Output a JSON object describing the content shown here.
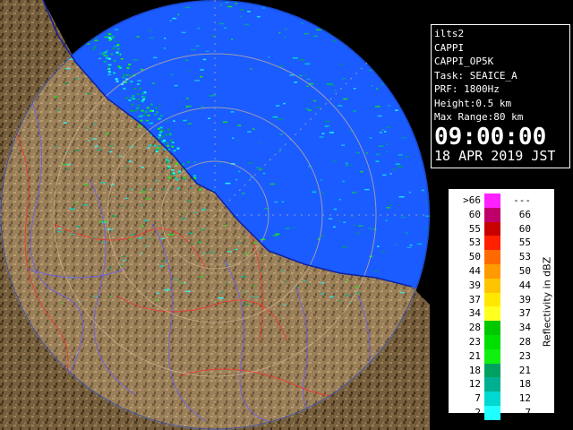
{
  "info": {
    "radar_name": "ilts2",
    "product": "CAPPI",
    "product_id": "CAPPI_OP5K",
    "task": "Task: SEAICE_A",
    "prf": "PRF: 1800Hz",
    "height": "Height:0.5 km",
    "max_range": "Max Range:80 km",
    "time": "09:00:00",
    "date": "18 APR 2019 JST"
  },
  "legend": {
    "title": "Reflectivity in dBZ",
    "rows": [
      {
        "lo": ">66",
        "hi": "---",
        "color": "#ff20ff"
      },
      {
        "lo": "60",
        "hi": "66",
        "color": "#c0006a"
      },
      {
        "lo": "55",
        "hi": "60",
        "color": "#c80000"
      },
      {
        "lo": "53",
        "hi": "55",
        "color": "#ff2000"
      },
      {
        "lo": "50",
        "hi": "53",
        "color": "#ff6a00"
      },
      {
        "lo": "44",
        "hi": "50",
        "color": "#ff9a00"
      },
      {
        "lo": "39",
        "hi": "44",
        "color": "#ffc400"
      },
      {
        "lo": "37",
        "hi": "39",
        "color": "#ffe800"
      },
      {
        "lo": "34",
        "hi": "37",
        "color": "#ffff20"
      },
      {
        "lo": "28",
        "hi": "34",
        "color": "#00c800"
      },
      {
        "lo": "23",
        "hi": "28",
        "color": "#00e000"
      },
      {
        "lo": "21",
        "hi": "23",
        "color": "#10f010"
      },
      {
        "lo": "18",
        "hi": "21",
        "color": "#00a060"
      },
      {
        "lo": "12",
        "hi": "18",
        "color": "#00b090"
      },
      {
        "lo": "7",
        "hi": "12",
        "color": "#00d8d0"
      },
      {
        "lo": "2",
        "hi": "7",
        "color": "#20ffff"
      }
    ]
  },
  "colors": {
    "sea_echo": "#1a5cff",
    "land": "#8a7048",
    "range_ring": "#d4b590",
    "river": "#6a5cff",
    "border": "#ff2a2a"
  }
}
